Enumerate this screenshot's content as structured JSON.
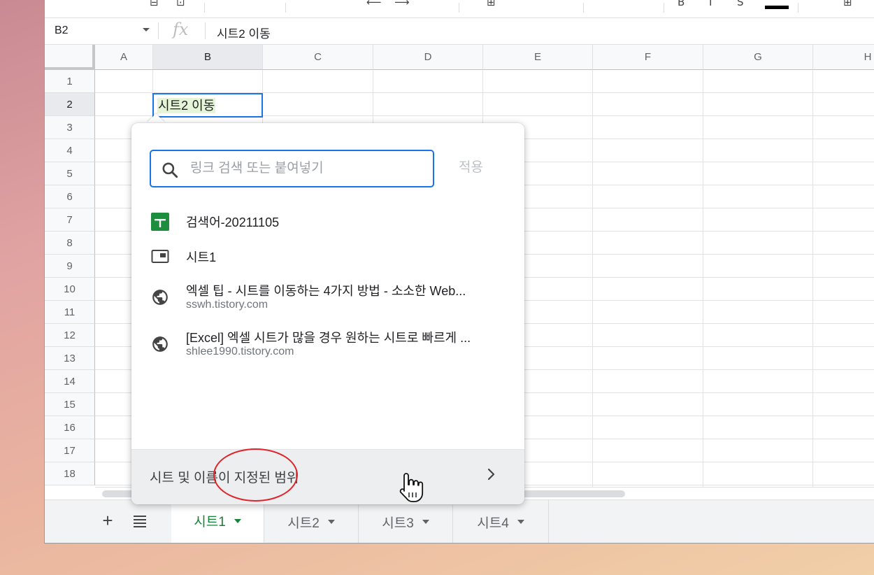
{
  "formula_bar": {
    "cell_ref": "B2",
    "fx_label": "fx",
    "content": "시트2 이동"
  },
  "grid": {
    "columns": [
      "A",
      "B",
      "C",
      "D",
      "E",
      "F",
      "G",
      "H"
    ],
    "rows": [
      "1",
      "2",
      "3",
      "4",
      "5",
      "6",
      "7",
      "8",
      "9",
      "10",
      "11",
      "12",
      "13",
      "14",
      "15",
      "16",
      "17",
      "18"
    ],
    "selected_column": "B",
    "selected_row": "2",
    "active_cell_value": "시트2 이동"
  },
  "link_popup": {
    "search_placeholder": "링크 검색 또는 붙여넣기",
    "apply_label": "적용",
    "suggestions": [
      {
        "icon": "google-sheets-icon",
        "title": "검색어-20211105",
        "subtitle": ""
      },
      {
        "icon": "sheet-tab-icon",
        "title": "시트1",
        "subtitle": ""
      },
      {
        "icon": "globe-icon",
        "title": "엑셀 팁 - 시트를 이동하는 4가지 방법 - 소소한 Web...",
        "subtitle": "sswh.tistory.com"
      },
      {
        "icon": "globe-icon",
        "title": "[Excel] 엑셀 시트가 많을 경우 원하는 시트로 빠르게 ...",
        "subtitle": "shlee1990.tistory.com"
      }
    ],
    "footer_label": "시트 및 이름이 지정된 범위"
  },
  "sheet_tabs": {
    "add_label": "+",
    "tabs": [
      {
        "label": "시트1",
        "active": true
      },
      {
        "label": "시트2",
        "active": false
      },
      {
        "label": "시트3",
        "active": false
      },
      {
        "label": "시트4",
        "active": false
      }
    ]
  },
  "colors": {
    "accent_blue": "#1a73e8",
    "sheets_green": "#188038",
    "annotation_red": "#e0232a"
  }
}
